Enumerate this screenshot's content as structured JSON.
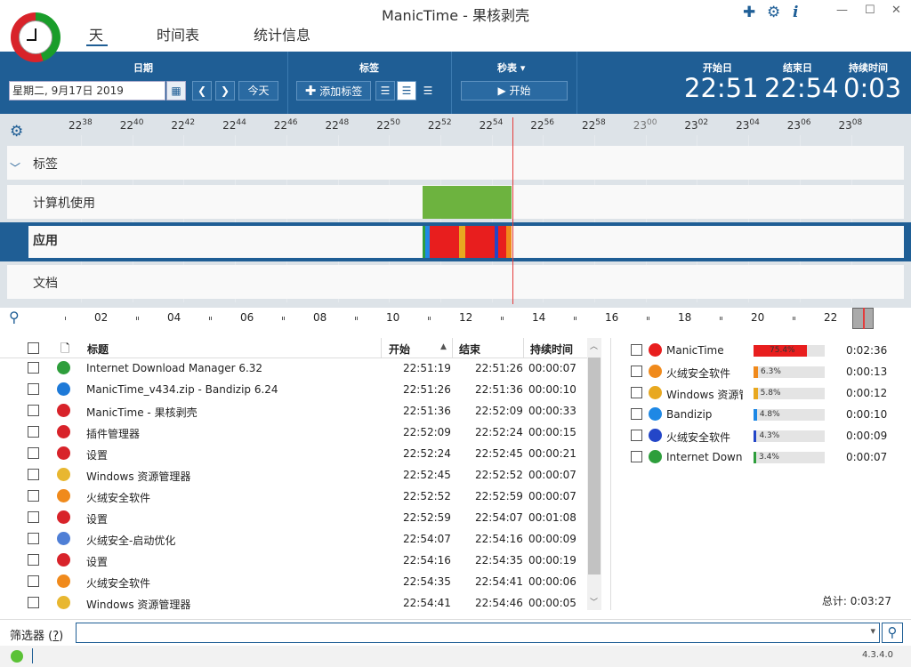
{
  "app": {
    "title": "ManicTime - 果核剥壳",
    "version": "4.3.4.0"
  },
  "nav": {
    "tabs": [
      "天",
      "时间表",
      "统计信息"
    ]
  },
  "toolbar": {
    "date_label": "日期",
    "date_value": "星期二, 9月17日 2019",
    "today": "今天",
    "tags_label": "标签",
    "add_tag": "添加标签",
    "stopwatch_label": "秒表",
    "start": "开始",
    "start_day_label": "开始日",
    "end_day_label": "结束日",
    "duration_label": "持续时间",
    "start_day": "22:51",
    "end_day": "22:54",
    "duration": "0:03"
  },
  "timeline": {
    "ticks": [
      [
        "22",
        "38"
      ],
      [
        "22",
        "40"
      ],
      [
        "22",
        "42"
      ],
      [
        "22",
        "44"
      ],
      [
        "22",
        "46"
      ],
      [
        "22",
        "48"
      ],
      [
        "22",
        "50"
      ],
      [
        "22",
        "52"
      ],
      [
        "22",
        "54"
      ],
      [
        "22",
        "56"
      ],
      [
        "22",
        "58"
      ],
      [
        "23",
        "00"
      ],
      [
        "23",
        "02"
      ],
      [
        "23",
        "04"
      ],
      [
        "23",
        "06"
      ],
      [
        "23",
        "08"
      ]
    ],
    "rows": [
      "标签",
      "计算机使用",
      "应用",
      "文档"
    ]
  },
  "overview": {
    "labels": [
      "02",
      "04",
      "06",
      "08",
      "10",
      "12",
      "14",
      "16",
      "18",
      "20",
      "22"
    ]
  },
  "list": {
    "headers": [
      "标题",
      "开始",
      "结束",
      "持续时间"
    ],
    "rows": [
      {
        "title": "Internet Download Manager 6.32",
        "start": "22:51:19",
        "end": "22:51:26",
        "dur": "00:00:07",
        "icon": "idm-icon",
        "color": "#2e9e3c"
      },
      {
        "title": "ManicTime_v434.zip - Bandizip 6.24",
        "start": "22:51:26",
        "end": "22:51:36",
        "dur": "00:00:10",
        "icon": "bandizip-icon",
        "color": "#1e7ad8"
      },
      {
        "title": "ManicTime - 果核剥壳",
        "start": "22:51:36",
        "end": "22:52:09",
        "dur": "00:00:33",
        "icon": "manictime-icon",
        "color": "#d8232a"
      },
      {
        "title": "插件管理器",
        "start": "22:52:09",
        "end": "22:52:24",
        "dur": "00:00:15",
        "icon": "manictime-icon",
        "color": "#d8232a"
      },
      {
        "title": "设置",
        "start": "22:52:24",
        "end": "22:52:45",
        "dur": "00:00:21",
        "icon": "manictime-icon",
        "color": "#d8232a"
      },
      {
        "title": "Windows 资源管理器",
        "start": "22:52:45",
        "end": "22:52:52",
        "dur": "00:00:07",
        "icon": "folder-icon",
        "color": "#e8b730"
      },
      {
        "title": "火绒安全软件",
        "start": "22:52:52",
        "end": "22:52:59",
        "dur": "00:00:07",
        "icon": "huorong-icon",
        "color": "#f08a1c"
      },
      {
        "title": "设置",
        "start": "22:52:59",
        "end": "22:54:07",
        "dur": "00:01:08",
        "icon": "manictime-icon",
        "color": "#d8232a"
      },
      {
        "title": "火绒安全-启动优化",
        "start": "22:54:07",
        "end": "22:54:16",
        "dur": "00:00:09",
        "icon": "monitor-icon",
        "color": "#4f7fd6"
      },
      {
        "title": "设置",
        "start": "22:54:16",
        "end": "22:54:35",
        "dur": "00:00:19",
        "icon": "manictime-icon",
        "color": "#d8232a"
      },
      {
        "title": "火绒安全软件",
        "start": "22:54:35",
        "end": "22:54:41",
        "dur": "00:00:06",
        "icon": "huorong-icon",
        "color": "#f08a1c"
      },
      {
        "title": "Windows 资源管理器",
        "start": "22:54:41",
        "end": "22:54:46",
        "dur": "00:00:05",
        "icon": "folder-icon",
        "color": "#e8b730"
      }
    ]
  },
  "summary": {
    "rows": [
      {
        "name": "ManicTime",
        "pct": "75.4%",
        "frac": 0.754,
        "color": "#e81e1e",
        "dur": "0:02:36"
      },
      {
        "name": "火绒安全软件",
        "pct": "6.3%",
        "frac": 0.063,
        "color": "#f08a1c",
        "dur": "0:00:13"
      },
      {
        "name": "Windows 资源管",
        "pct": "5.8%",
        "frac": 0.058,
        "color": "#e8a820",
        "dur": "0:00:12"
      },
      {
        "name": "Bandizip",
        "pct": "4.8%",
        "frac": 0.048,
        "color": "#1e88e5",
        "dur": "0:00:10"
      },
      {
        "name": "火绒安全软件",
        "pct": "4.3%",
        "frac": 0.043,
        "color": "#2346c8",
        "dur": "0:00:09"
      },
      {
        "name": "Internet Downl",
        "pct": "3.4%",
        "frac": 0.034,
        "color": "#2e9e3c",
        "dur": "0:00:07"
      }
    ],
    "total": "总计: 0:03:27"
  },
  "filter": {
    "label": "筛选器",
    "help": "?"
  }
}
